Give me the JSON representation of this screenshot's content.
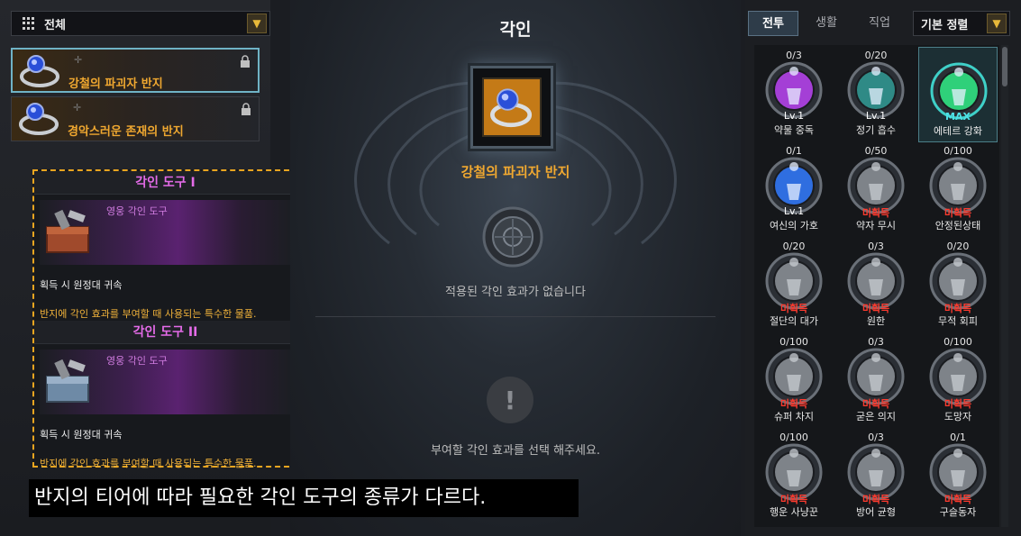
{
  "filter": {
    "label": "전체"
  },
  "ring_list": [
    {
      "name": "강철의 파괴자 반지",
      "selected": true
    },
    {
      "name": "경악스러운 존재의 반지",
      "selected": false
    }
  ],
  "tooltip": {
    "sections": [
      {
        "title": "각인 도구 I",
        "grade": "영웅 각인 도구",
        "bind": "획득 시 원정대 귀속",
        "desc": "반지에 각인 효과를 부여할 때 사용되는 특수한 물품."
      },
      {
        "title": "각인 도구 II",
        "grade": "영웅 각인 도구",
        "bind": "획득 시 원정대 귀속",
        "desc": "반지에 각인 효과를 부여할 때 사용되는 특수한 물품."
      }
    ]
  },
  "caption": "반지의 티어에 따라 필요한 각인 도구의 종류가 다르다.",
  "center": {
    "title": "각인",
    "ring_name": "강철의 파괴자 반지",
    "no_effect": "적용된 각인 효과가 없습니다",
    "warn_symbol": "!",
    "select_msg": "부여할 각인 효과를 선택 해주세요."
  },
  "tabs": [
    {
      "label": "전투",
      "active": true
    },
    {
      "label": "생활",
      "active": false
    },
    {
      "label": "직업",
      "active": false
    }
  ],
  "sort": {
    "label": "기본 정렬"
  },
  "engravings": [
    {
      "count": "0/3",
      "state": "Lv.1",
      "name": "약물 중독",
      "kind": "lv",
      "color": "#a43fd6"
    },
    {
      "count": "0/20",
      "state": "Lv.1",
      "name": "정기 흡수",
      "kind": "lv",
      "color": "#2f8a86"
    },
    {
      "count": "",
      "state": "MAX",
      "name": "에테르 강화",
      "kind": "max",
      "color": "#2fd07a",
      "selected": true
    },
    {
      "count": "0/1",
      "state": "Lv.1",
      "name": "여신의 가호",
      "kind": "lv",
      "color": "#2f6ee0"
    },
    {
      "count": "0/50",
      "state": "미획득",
      "name": "약자 무시",
      "kind": "na",
      "color": "#7e8389"
    },
    {
      "count": "0/100",
      "state": "미획득",
      "name": "안정된상태",
      "kind": "na",
      "color": "#7e8389"
    },
    {
      "count": "0/20",
      "state": "미획득",
      "name": "절단의 대가",
      "kind": "na",
      "color": "#7e8389"
    },
    {
      "count": "0/3",
      "state": "미획득",
      "name": "원한",
      "kind": "na",
      "color": "#7e8389"
    },
    {
      "count": "0/20",
      "state": "미획득",
      "name": "무적 회피",
      "kind": "na",
      "color": "#7e8389"
    },
    {
      "count": "0/100",
      "state": "미획득",
      "name": "슈퍼 차지",
      "kind": "na",
      "color": "#7e8389"
    },
    {
      "count": "0/3",
      "state": "미획득",
      "name": "굳은 의지",
      "kind": "na",
      "color": "#7e8389"
    },
    {
      "count": "0/100",
      "state": "미획득",
      "name": "도망자",
      "kind": "na",
      "color": "#7e8389"
    },
    {
      "count": "0/100",
      "state": "미획득",
      "name": "행운 사냥꾼",
      "kind": "na",
      "color": "#7e8389"
    },
    {
      "count": "0/3",
      "state": "미획득",
      "name": "방어 균형",
      "kind": "na",
      "color": "#7e8389"
    },
    {
      "count": "0/1",
      "state": "미획득",
      "name": "구슬동자",
      "kind": "na",
      "color": "#7e8389"
    }
  ]
}
